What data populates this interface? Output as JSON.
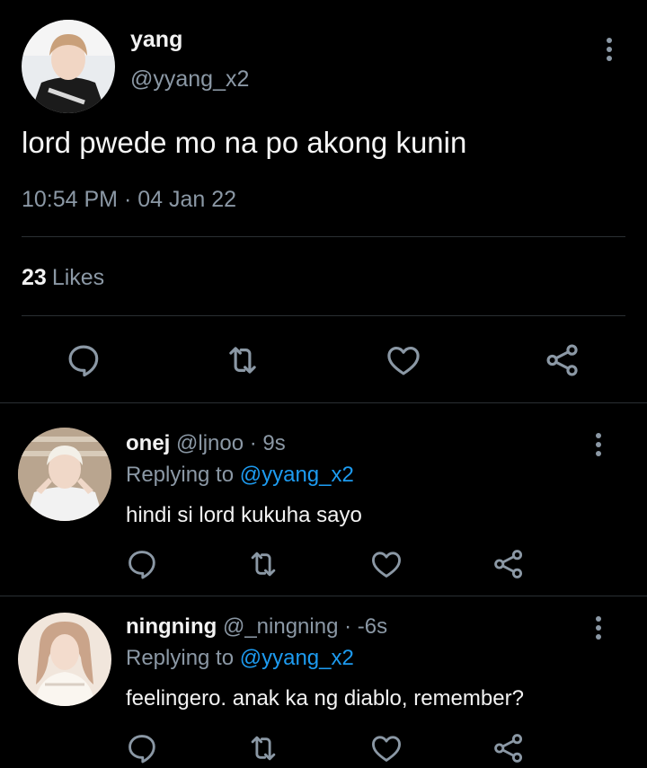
{
  "main_tweet": {
    "author_name": "yang",
    "author_handle": "@yyang_x2",
    "text": "lord pwede mo na po akong kunin",
    "timestamp": "10:54 PM · 04 Jan 22",
    "likes_count": "23",
    "likes_label": "Likes",
    "actions": [
      "reply-icon",
      "retweet-icon",
      "like-icon",
      "share-icon"
    ]
  },
  "replies": [
    {
      "author_name": "onej",
      "author_handle": "@ljnoo",
      "time": "· 9s",
      "replying_label": "Replying to",
      "replying_to": "@yyang_x2",
      "text": "hindi si lord kukuha sayo"
    },
    {
      "author_name": "ningning",
      "author_handle": "@_ningning",
      "time": "· -6s",
      "replying_label": "Replying to",
      "replying_to": "@yyang_x2",
      "text": "feelingero. anak ka ng diablo, remember?"
    }
  ],
  "colors": {
    "background": "#000000",
    "primary_text": "#e7e9ea",
    "secondary_text": "#8b98a5",
    "link": "#1d9bf0",
    "divider": "#2a2f33"
  }
}
